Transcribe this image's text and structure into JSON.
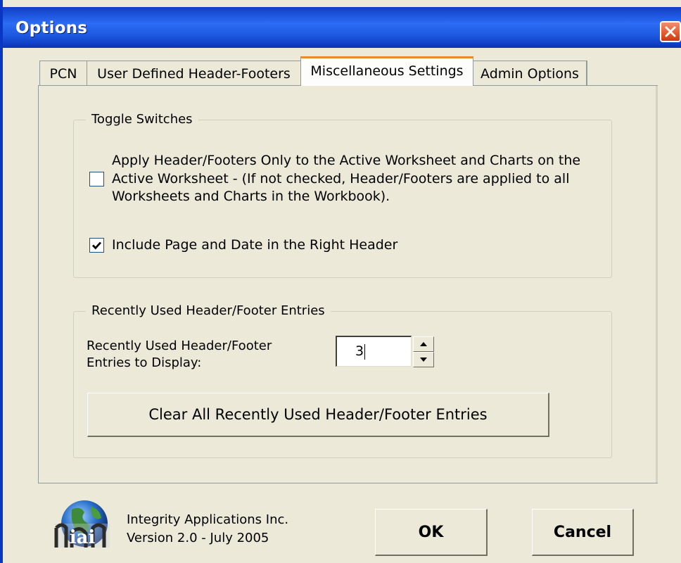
{
  "window": {
    "title": "Options"
  },
  "tabs": [
    {
      "label": "PCN",
      "active": false
    },
    {
      "label": "User Defined Header-Footers",
      "active": false
    },
    {
      "label": "Miscellaneous Settings",
      "active": true
    },
    {
      "label": "Admin Options",
      "active": false
    }
  ],
  "toggle_group": {
    "label": "Toggle Switches",
    "options": [
      {
        "label": "Apply Header/Footers Only to the Active Worksheet and Charts on the Active Worksheet - (If not checked, Header/Footers are applied to all Worksheets and Charts in the Workbook).",
        "checked": false
      },
      {
        "label": "Include Page and Date in the Right Header",
        "checked": true
      }
    ]
  },
  "recent_group": {
    "label": "Recently Used Header/Footer Entries",
    "display_label_line1": "Recently Used Header/Footer",
    "display_label_line2": "Entries to Display:",
    "display_value": "3",
    "clear_button": "Clear All Recently Used Header/Footer Entries"
  },
  "footer": {
    "company": "Integrity Applications Inc.",
    "version": "Version 2.0 - July 2005",
    "ok_label": "OK",
    "cancel_label": "Cancel",
    "logo_text": "iai"
  },
  "icons": {
    "close": "close-icon",
    "spin_up": "arrow-up-icon",
    "spin_down": "arrow-down-icon",
    "check": "checkmark-icon",
    "logo": "globe-logo-icon"
  },
  "colors": {
    "titlebar": "#0a36c4",
    "dialog_bg": "#ece9d8",
    "close_button": "#e25a2c"
  }
}
